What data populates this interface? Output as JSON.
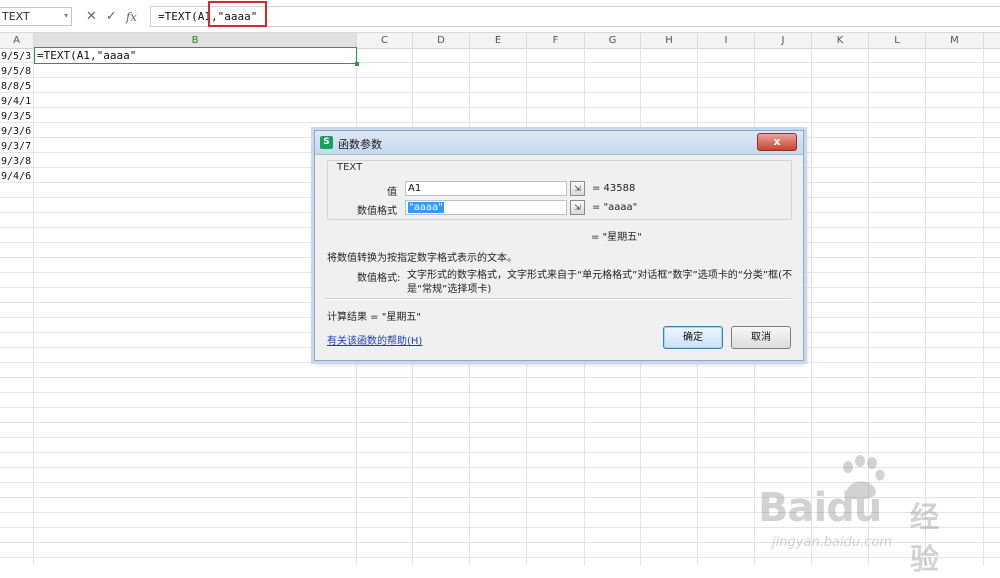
{
  "formula_bar": {
    "name_box": "TEXT",
    "cancel_icon": "close-icon",
    "enter_icon": "check-icon",
    "fx_label": "fx",
    "formula": "=TEXT(A1,\"aaaa\""
  },
  "columns": [
    "A",
    "B",
    "C",
    "D",
    "E",
    "F",
    "G",
    "H",
    "I",
    "J",
    "K",
    "L",
    "M"
  ],
  "cells": {
    "a_column": [
      "9/5/3",
      "9/5/8",
      "8/8/5",
      "9/4/1",
      "9/3/5",
      "9/3/6",
      "9/3/7",
      "9/3/8",
      "9/4/6"
    ],
    "active_b1": "=TEXT(A1,\"aaaa\""
  },
  "dialog": {
    "title": "函数参数",
    "close_label": "x",
    "function_name": "TEXT",
    "args": [
      {
        "label": "值",
        "input": "A1",
        "value": "= 43588"
      },
      {
        "label": "数值格式",
        "input": "\"aaaa\"",
        "value": "= \"aaaa\""
      }
    ],
    "result_preview": "= \"星期五\"",
    "description": "将数值转换为按指定数字格式表示的文本。",
    "param_name": "数值格式:",
    "param_desc": "文字形式的数字格式，文字形式来自于“单元格格式”对话框“数字”选项卡的“分类”框(不是“常规”选择项卡)",
    "calc_result": "计算结果 = \"星期五\"",
    "help_link": "有关该函数的帮助(H)",
    "ok_label": "确定",
    "cancel_label": "取消"
  },
  "watermark": {
    "line1": "Bai",
    "line1b": "du",
    "line2": "经验",
    "line3": "jingyan.baidu.com"
  }
}
